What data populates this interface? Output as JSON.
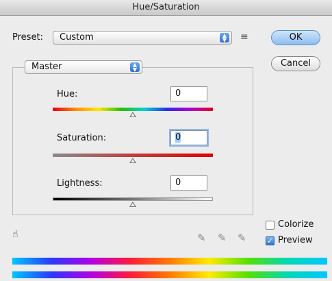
{
  "window": {
    "title": "Hue/Saturation"
  },
  "preset": {
    "label": "Preset:",
    "value": "Custom",
    "options_icon": "preset-options-icon"
  },
  "buttons": {
    "ok": "OK",
    "cancel": "Cancel"
  },
  "channel": {
    "value": "Master"
  },
  "sliders": {
    "hue": {
      "label": "Hue:",
      "value": "0",
      "position_fraction": 0.5
    },
    "saturation": {
      "label": "Saturation:",
      "value": "0",
      "position_fraction": 0.5
    },
    "lightness": {
      "label": "Lightness:",
      "value": "0",
      "position_fraction": 0.5
    }
  },
  "options": {
    "colorize": {
      "label": "Colorize",
      "checked": false
    },
    "preview": {
      "label": "Preview",
      "checked": true
    }
  },
  "tools": [
    "hand-adjust-icon",
    "eyedropper-icon",
    "eyedropper-plus-icon",
    "eyedropper-minus-icon"
  ],
  "colors": {
    "accent": "#2f74d6",
    "window_bg": "#ececec"
  }
}
